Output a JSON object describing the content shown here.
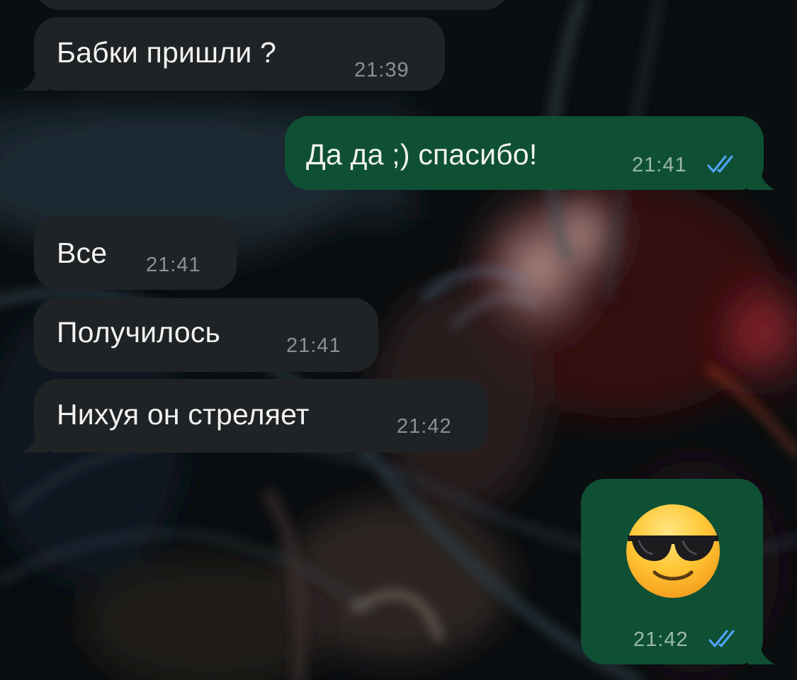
{
  "messages": [
    {
      "direction": "incoming",
      "text": "Бабки пришли ?",
      "time": "21:39"
    },
    {
      "direction": "outgoing",
      "text": "Да да ;)  спасибо!",
      "time": "21:41",
      "status": "read"
    },
    {
      "direction": "incoming",
      "text": "Все",
      "time": "21:41"
    },
    {
      "direction": "incoming",
      "text": "Получилось",
      "time": "21:41"
    },
    {
      "direction": "incoming",
      "text": "Нихуя он стреляет",
      "time": "21:42"
    },
    {
      "direction": "outgoing",
      "emoji": "smiling-face-with-sunglasses",
      "time": "21:42",
      "status": "read"
    }
  ],
  "colors": {
    "incoming_bubble": "#202325",
    "outgoing_bubble": "#0f5035",
    "read_ticks": "#53a6ff"
  }
}
